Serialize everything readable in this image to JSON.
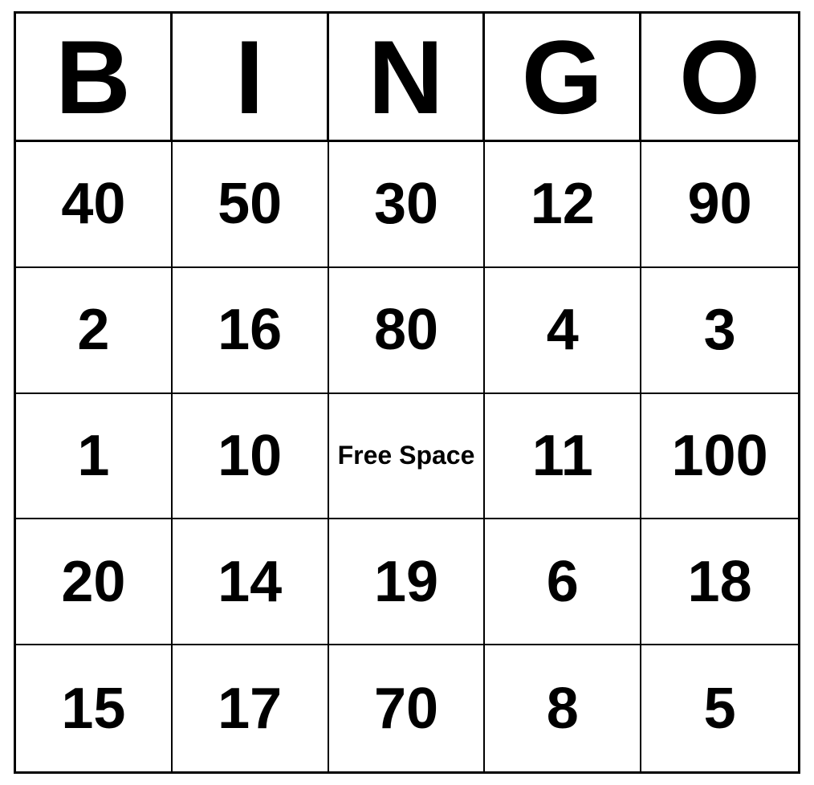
{
  "header": {
    "letters": [
      "B",
      "I",
      "N",
      "G",
      "O"
    ]
  },
  "grid": {
    "rows": [
      [
        "40",
        "50",
        "30",
        "12",
        "90"
      ],
      [
        "2",
        "16",
        "80",
        "4",
        "3"
      ],
      [
        "1",
        "10",
        "FREE_SPACE",
        "11",
        "100"
      ],
      [
        "20",
        "14",
        "19",
        "6",
        "18"
      ],
      [
        "15",
        "17",
        "70",
        "8",
        "5"
      ]
    ],
    "free_space_label": "Free Space"
  }
}
